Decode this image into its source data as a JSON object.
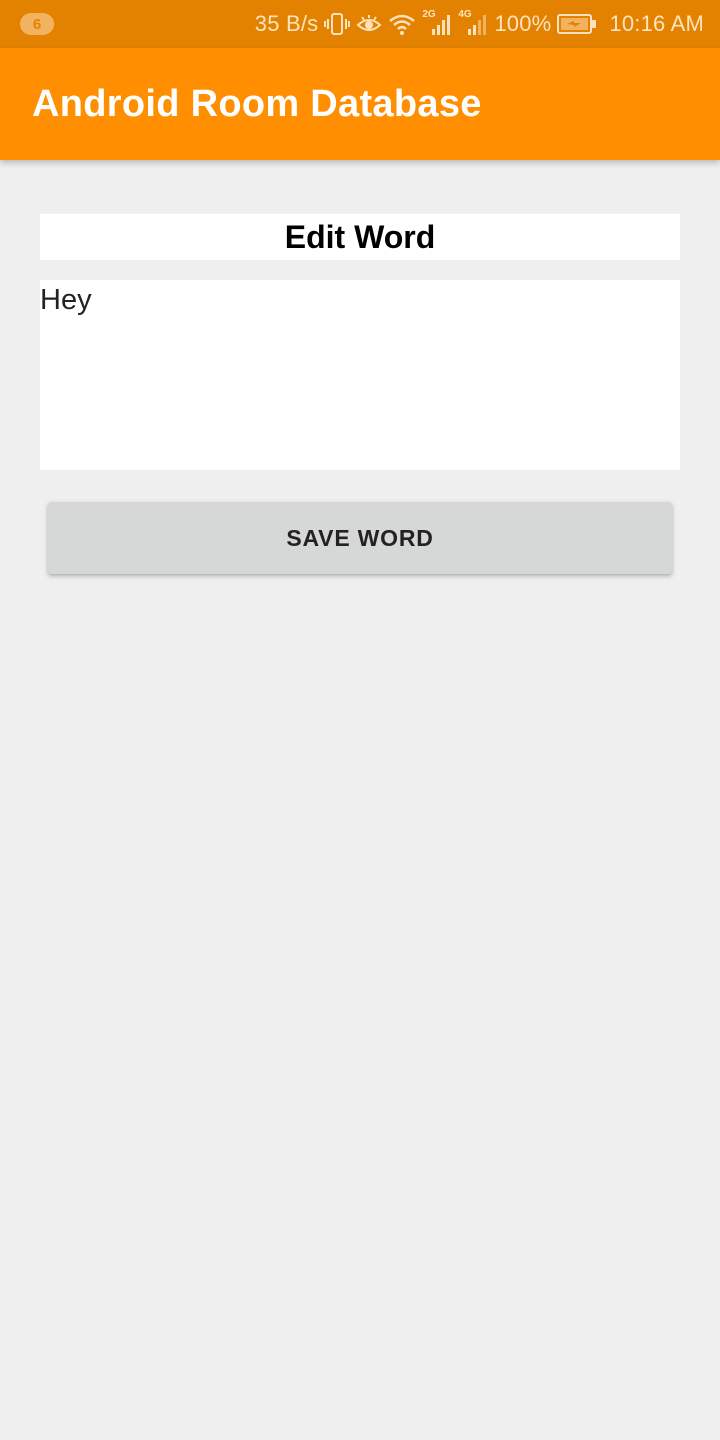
{
  "status_bar": {
    "notification_count": "6",
    "net_speed": "35 B/s",
    "signal_1_label": "2G",
    "signal_2_label": "4G",
    "battery": "100%",
    "time": "10:16 AM",
    "icons": [
      "vibrate-icon",
      "eye-icon",
      "wifi-icon",
      "signal-2g-icon",
      "signal-4g-icon",
      "battery-charging-icon"
    ]
  },
  "app_bar": {
    "title": "Android Room Database"
  },
  "form": {
    "heading": "Edit Word",
    "word_value": "Hey",
    "save_label": "SAVE WORD"
  },
  "colors": {
    "status_bar": "#e38200",
    "app_bar": "#ff8f00",
    "background": "#efefef",
    "button": "#d6d7d7"
  }
}
